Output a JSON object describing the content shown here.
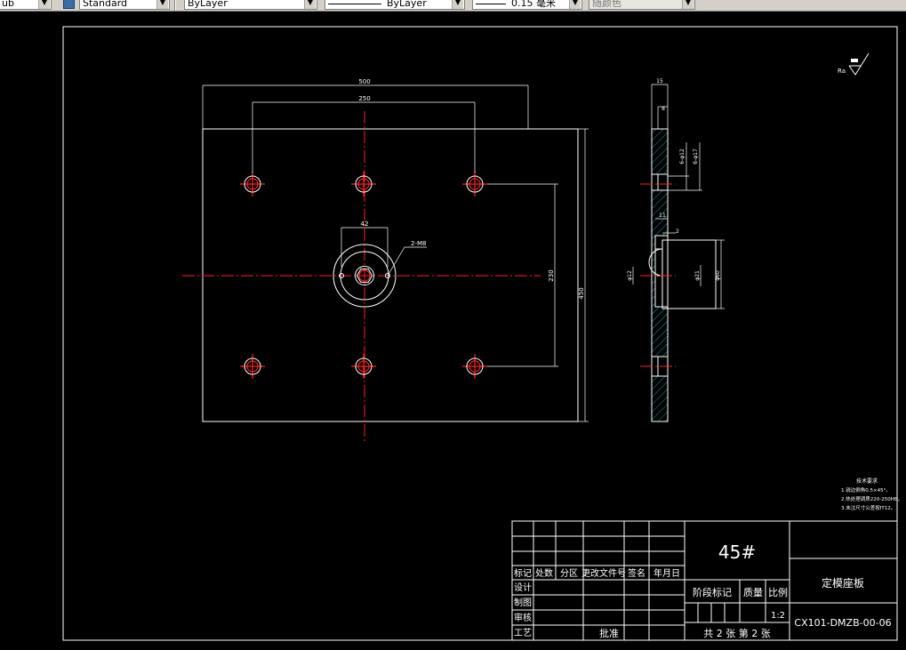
{
  "toolbar": {
    "textstyle_partial": "ub",
    "dimstyle": "Standard",
    "layer": "ByLayer",
    "linetype": "ByLayer",
    "lineweight": "0.15 毫米",
    "plotstyle": "随颜色"
  },
  "drawing": {
    "dims": {
      "width_500": "500",
      "spacing_250": "250",
      "hub_42": "42",
      "thread_note": "2-M8",
      "height_230": "230",
      "height_450": "450",
      "thick_15": "15",
      "step_8": "8",
      "hole_d12": "6-φ12",
      "hole_d17": "6-φ17",
      "hub_11": "11",
      "hub_2": "2",
      "bore_12": "φ12",
      "bore_21": "φ21",
      "bore_60": "φ60"
    },
    "roughness": "Ra"
  },
  "tech_req": {
    "title": "技术要求",
    "lines": [
      "1.锐边倒角0.5×45°。",
      "2.热处理调质220-250HB。",
      "3.未注尺寸公差按IT12。"
    ]
  },
  "title_block": {
    "material": "45#",
    "part_name": "定模座板",
    "drawing_no": "CX101-DMZB-00-06",
    "scale": "1:2",
    "sheets": "共 2 张   第 2 张",
    "headers": [
      "标记",
      "处数",
      "分区",
      "更改文件号",
      "签名",
      "年月日"
    ],
    "roles": [
      "设计",
      "制图",
      "审核",
      "工艺"
    ],
    "stage_label": "阶段标记",
    "mass_label": "质量",
    "scale_label": "比例",
    "approve_label": "批准"
  }
}
